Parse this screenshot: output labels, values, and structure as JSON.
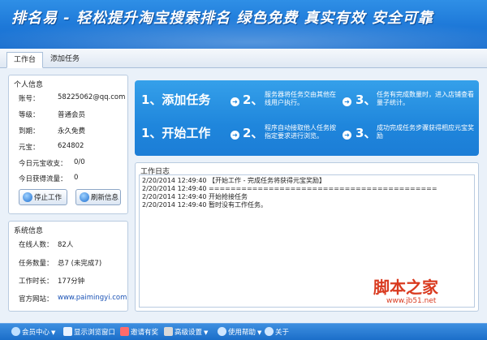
{
  "banner": {
    "text": "排名易 - 轻松提升淘宝搜索排名   绿色免费  真实有效  安全可靠"
  },
  "tabs": [
    {
      "label": "工作台",
      "active": true
    },
    {
      "label": "添加任务",
      "active": false
    }
  ],
  "personal": {
    "title": "个人信息",
    "rows": [
      {
        "label": "账号：",
        "value": "58225062@qq.com"
      },
      {
        "label": "等级：",
        "value": "普通会员"
      },
      {
        "label": "到期：",
        "value": "永久免费"
      },
      {
        "label": "元宝：",
        "value": "624802"
      },
      {
        "label": "今日元宝收支：",
        "value": "0/0"
      },
      {
        "label": "今日获得流量：",
        "value": "0"
      }
    ],
    "stop_button": "停止工作",
    "refresh_button": "刷新信息"
  },
  "system": {
    "title": "系统信息",
    "rows": [
      {
        "label": "在线人数：",
        "value": "82人"
      },
      {
        "label": "任务数量：",
        "value": "总7 (未完成7)"
      },
      {
        "label": "工作时长：",
        "value": "177分钟"
      },
      {
        "label": "官方网站：",
        "value": "www.paimingyi.com"
      }
    ]
  },
  "steps": {
    "row1": {
      "big": "1、添加任务",
      "s2num": "2、",
      "s2": "服务器将任务交由其他在线用户执行。",
      "s3num": "3、",
      "s3": "任务有完成数量时，进入店铺查看量子统计。"
    },
    "row2": {
      "big": "1、开始工作",
      "s2num": "2、",
      "s2": "程序自动接取他人任务按指定要求进行浏览。",
      "s3num": "3、",
      "s3": "成功完成任务步骤获得相应元宝奖励"
    }
  },
  "log": {
    "title": "工作日志",
    "lines": [
      "2/20/2014 12:49:40  【开始工作 - 完成任务将获得元宝奖励】",
      "2/20/2014 12:49:40  ==========================================",
      "2/20/2014 12:49:40  开始抢接任务",
      "2/20/2014 12:49:40  暂时没有工作任务。"
    ]
  },
  "statusbar": [
    {
      "label": "会员中心",
      "caret": true
    },
    {
      "label": "显示浏览窗口",
      "caret": false
    },
    {
      "label": "邀请有奖",
      "caret": false
    },
    {
      "label": "高级设置",
      "caret": true
    },
    {
      "label": "使用帮助",
      "caret": true
    },
    {
      "label": "关于",
      "caret": false
    }
  ],
  "watermark": {
    "text": "脚本之家",
    "url": "www.jb51.net"
  }
}
